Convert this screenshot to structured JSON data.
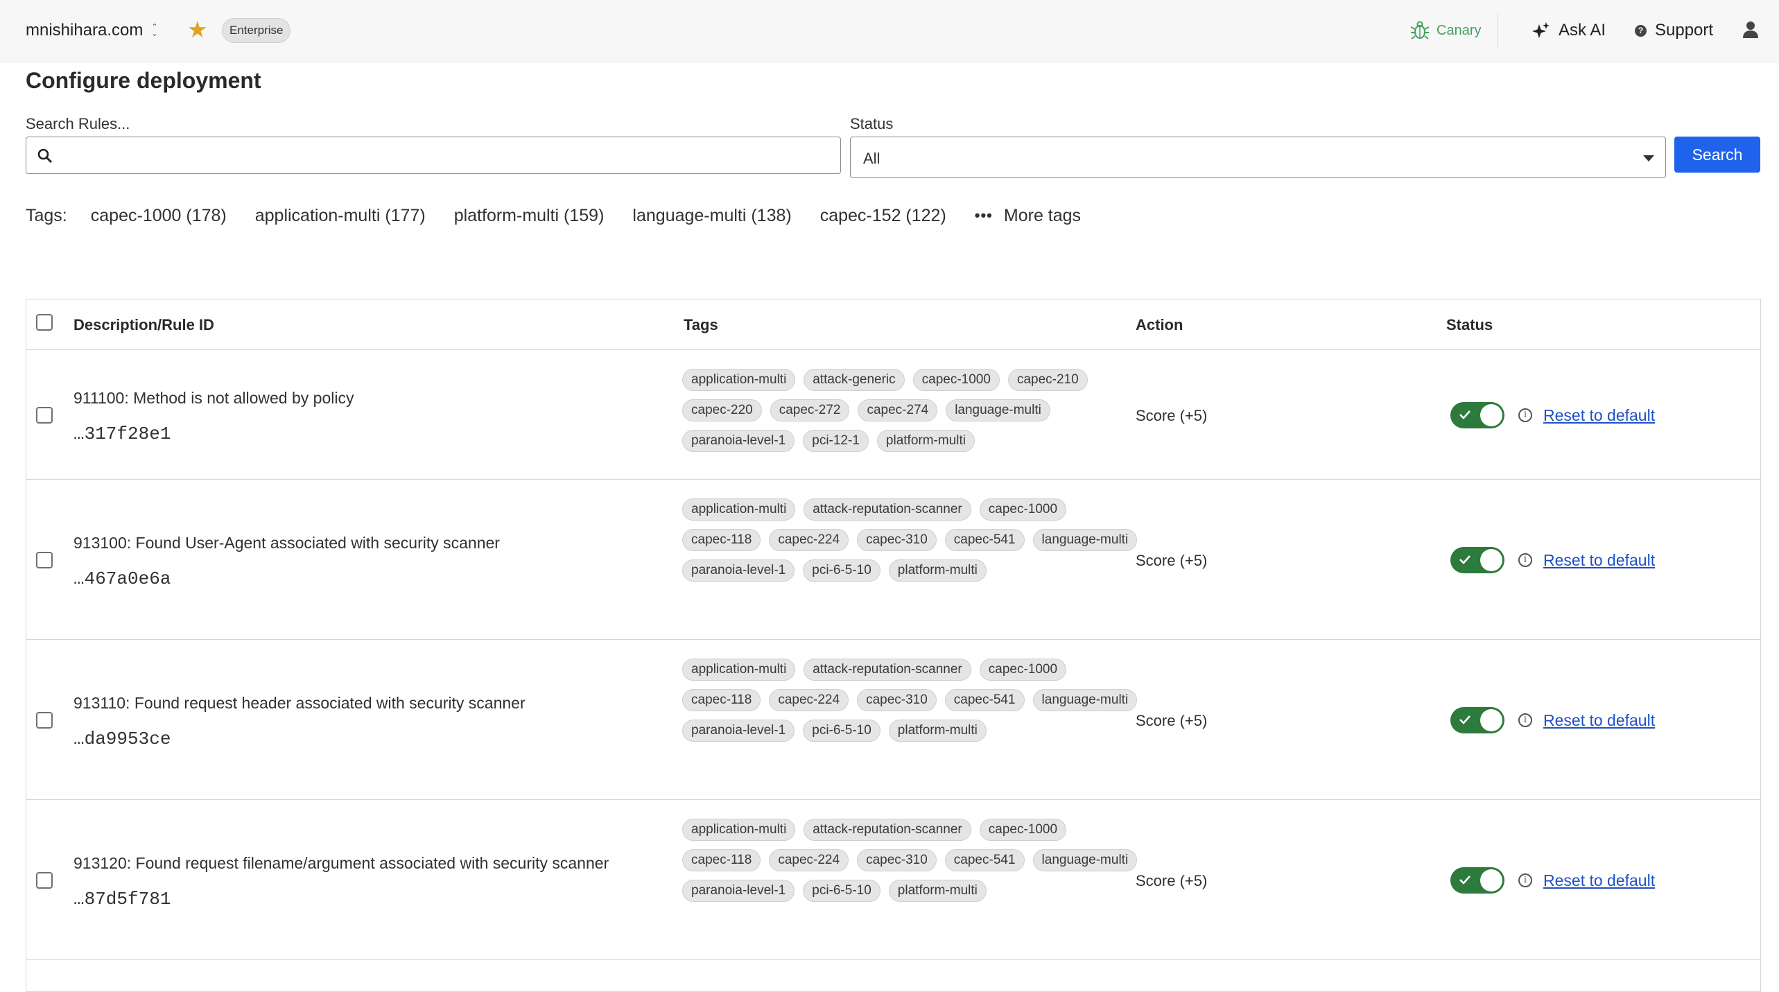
{
  "header": {
    "account": "mnishihara.com",
    "plan_badge": "Enterprise",
    "canary": "Canary",
    "ask_ai": "Ask AI",
    "support": "Support"
  },
  "page": {
    "title": "Configure deployment"
  },
  "filters": {
    "search_label": "Search Rules...",
    "search_value": "",
    "status_label": "Status",
    "status_value": "All",
    "search_button": "Search"
  },
  "tags_bar": {
    "label": "Tags:",
    "tags": [
      "capec-1000 (178)",
      "application-multi (177)",
      "platform-multi (159)",
      "language-multi (138)",
      "capec-152 (122)"
    ],
    "more": "More tags"
  },
  "table": {
    "columns": {
      "description": "Description/Rule ID",
      "tags": "Tags",
      "action": "Action",
      "status": "Status"
    },
    "reset_label": "Reset to default",
    "rows": [
      {
        "description": "911100: Method is not allowed by policy",
        "rule_id": "…317f28e1",
        "action": "Score (+5)",
        "enabled": true,
        "tags": [
          "application-multi",
          "attack-generic",
          "capec-1000",
          "capec-210",
          "capec-220",
          "capec-272",
          "capec-274",
          "language-multi",
          "paranoia-level-1",
          "pci-12-1",
          "platform-multi"
        ]
      },
      {
        "description": "913100: Found User-Agent associated with security scanner",
        "rule_id": "…467a0e6a",
        "action": "Score (+5)",
        "enabled": true,
        "tags": [
          "application-multi",
          "attack-reputation-scanner",
          "capec-1000",
          "capec-118",
          "capec-224",
          "capec-310",
          "capec-541",
          "language-multi",
          "paranoia-level-1",
          "pci-6-5-10",
          "platform-multi"
        ]
      },
      {
        "description": "913110: Found request header associated with security scanner",
        "rule_id": "…da9953ce",
        "action": "Score (+5)",
        "enabled": true,
        "tags": [
          "application-multi",
          "attack-reputation-scanner",
          "capec-1000",
          "capec-118",
          "capec-224",
          "capec-310",
          "capec-541",
          "language-multi",
          "paranoia-level-1",
          "pci-6-5-10",
          "platform-multi"
        ]
      },
      {
        "description": "913120: Found request filename/argument associated with security scanner",
        "rule_id": "…87d5f781",
        "action": "Score (+5)",
        "enabled": true,
        "tags": [
          "application-multi",
          "attack-reputation-scanner",
          "capec-1000",
          "capec-118",
          "capec-224",
          "capec-310",
          "capec-541",
          "language-multi",
          "paranoia-level-1",
          "pci-6-5-10",
          "platform-multi"
        ]
      }
    ]
  }
}
